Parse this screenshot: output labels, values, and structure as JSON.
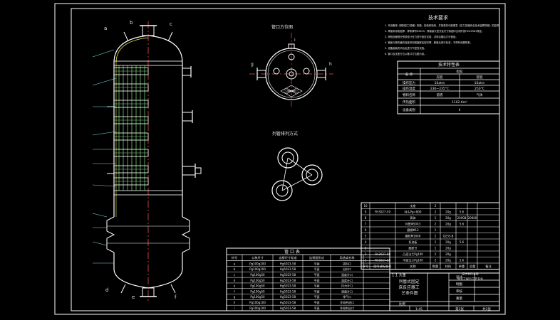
{
  "drawing": {
    "tech_requirements": {
      "title": "技术要求",
      "lines": [
        "1. 本设备按《钢制压力容器》制造、检验和验收，并接受劳动部颁发《压力容器安全技术监察规程》的监督。",
        "2. 焊接采用电弧焊，焊条牌号E4303，焊接接头型式及尺寸除图中注明外按HG20583规定。",
        "3. 壳程及管程分别按设计压力进行液压试验，试验合格后方可使用。",
        "4. 管板与换热管的连接采用强度胀加密封焊，胀管后进行检查，不得有泄漏现象。",
        "5. 设备组装完毕后应进行气密性试验。",
        "6. 管口及支座方位以管口方位图为准。"
      ]
    },
    "nozzle_orientation_title": "管口方位图",
    "tube_layout_title": "列管排列方式",
    "tech_characteristics": {
      "title": "技术特性表",
      "header": [
        "名 称",
        "指标",
        "壳程",
        "管程"
      ],
      "rows": [
        [
          "操作压力",
          "10atm",
          "10atm"
        ],
        [
          "操作温度",
          "230~235°C",
          "250°C"
        ],
        [
          "物料名称",
          "溶液",
          "气体"
        ],
        [
          "传热面积",
          "1102.6m²",
          ""
        ],
        [
          "设备类别",
          "II",
          ""
        ]
      ]
    },
    "nozzle_table": {
      "title": "管 口 表",
      "header": [
        "符号",
        "公称尺寸",
        "连接尺寸标准",
        "连接面形式",
        "用途或名称"
      ],
      "rows": [
        [
          "a",
          "Pg100g200",
          "Hg5023-58",
          "平面",
          "进料口"
        ],
        [
          "b",
          "Pg100g200",
          "Hg5023-58",
          "平面",
          "出料口"
        ],
        [
          "c",
          "Pg100g50",
          "Hg5023-58",
          "平面",
          "温度计口"
        ],
        [
          "d",
          "Pg100g50",
          "Hg5023-58",
          "平面",
          "温度计口"
        ],
        [
          "e",
          "Pg100g50",
          "Hg5023-58",
          "平面",
          "压力计口"
        ],
        [
          "f",
          "Pg100g50",
          "Hg5023-58",
          "平面",
          "液面计口"
        ],
        [
          "g",
          "Pg100g50",
          "Hg5023-58",
          "平面",
          "排气口"
        ],
        [
          "h",
          "Pg100g100",
          "Hg5023-58",
          "平面",
          "冷却剂进口"
        ],
        [
          "i",
          "Pg100g100",
          "Hg5023-58",
          "平面",
          "冷却剂出口"
        ]
      ]
    },
    "parts_list": {
      "header": [
        "序号",
        "图号或标准号",
        "名称",
        "数量",
        "材料",
        "单重",
        "总重",
        "备注"
      ],
      "rows": [
        [
          "10",
          "",
          "支座",
          "2",
          "",
          "",
          "",
          ""
        ],
        [
          "9",
          "FH3027-59",
          "封头Pg=800",
          "2",
          "20g",
          "5.6",
          "",
          ""
        ],
        [
          "8",
          "",
          "筒体",
          "1",
          "20g",
          "20008",
          "20600",
          ""
        ],
        [
          "7",
          "",
          "列管Φ50X3",
          "2",
          "20g",
          "5.6",
          "",
          ""
        ],
        [
          "6",
          "",
          "圆钢Φ12",
          "1",
          "",
          "",
          "",
          ""
        ],
        [
          "5",
          "",
          "螺栓M30X6",
          "2",
          "Q235-B",
          "",
          "",
          ""
        ],
        [
          "4",
          "",
          "折流板",
          "1",
          "20g",
          "5.6",
          "",
          ""
        ],
        [
          "3",
          "",
          "膨胀节",
          "1",
          "20g",
          "",
          "",
          ""
        ],
        [
          "2",
          "FH3027-59",
          "凸面法兰Pg100",
          "2",
          "20g",
          "",
          "",
          ""
        ],
        [
          "1",
          "FH3027-59",
          "平面法兰Pg100",
          "2",
          "20g",
          "5.6",
          "",
          ""
        ]
      ],
      "sub_label": "1:1 大量",
      "right_note": "设计单位名称",
      "school_note": "化学工程与工艺专业"
    },
    "title_block": {
      "drawing_title": "列管式固定床反应器工艺条件图",
      "scale": "1:45",
      "sheet": "第1张",
      "total": "共1张",
      "labels": [
        "设计",
        "制图",
        "审核",
        "比例",
        "重量"
      ]
    },
    "balloon_labels": [
      "a",
      "b",
      "c",
      "d",
      "e",
      "f",
      "g",
      "h",
      "i"
    ],
    "colors": {
      "background": "#000000",
      "frame": "#ffffff",
      "outline": "#ffffff",
      "center_line": "#e65050",
      "hatch": "#e6e64a",
      "tube": "#7fe07f",
      "leader": "#7fe0e0",
      "text": "#e8e8e8"
    }
  }
}
